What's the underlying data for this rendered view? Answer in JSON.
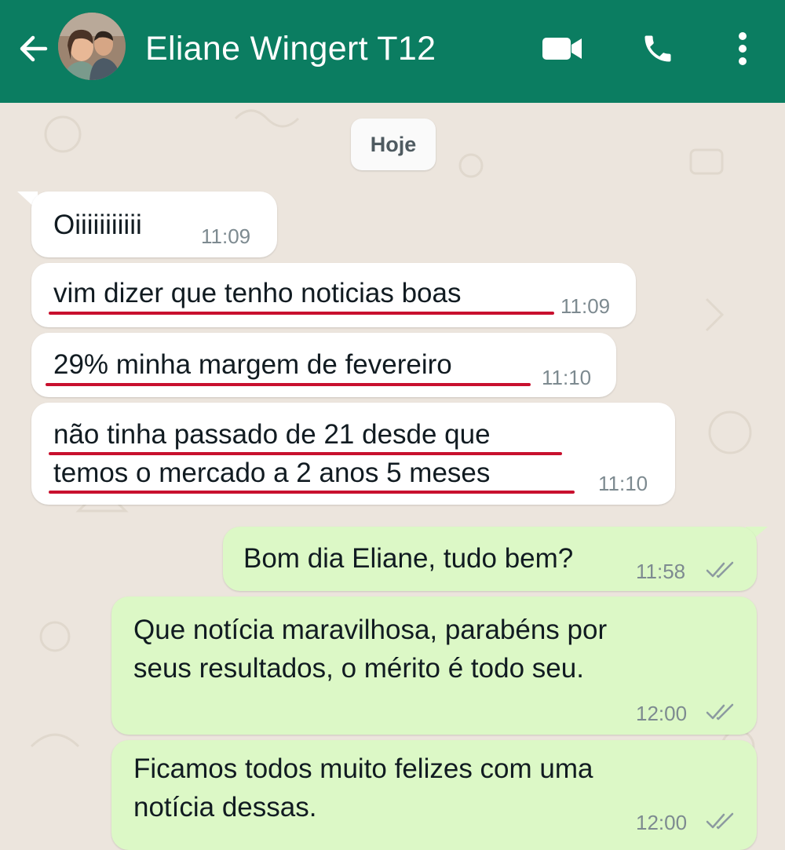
{
  "header": {
    "contact_name": "Eliane Wingert T12",
    "back_icon": "arrow-left-icon",
    "video_icon": "video-camera-icon",
    "call_icon": "phone-icon",
    "menu_icon": "more-vertical-icon",
    "background_color": "#0b7d61"
  },
  "chat": {
    "date_label": "Hoje",
    "messages": [
      {
        "direction": "incoming",
        "text": "Oiiiiiiiiiii",
        "time": "11:09",
        "underlined": false
      },
      {
        "direction": "incoming",
        "text": "vim dizer que tenho noticias boas",
        "time": "11:09",
        "underlined": true
      },
      {
        "direction": "incoming",
        "text": "29% minha margem de fevereiro",
        "time": "11:10",
        "underlined": true
      },
      {
        "direction": "incoming",
        "text": "não tinha passado de 21 desde que\ntemos o mercado a 2 anos 5 meses",
        "time": "11:10",
        "underlined": true
      },
      {
        "direction": "outgoing",
        "text": "Bom dia Eliane, tudo bem?",
        "time": "11:58",
        "status": "read-double-check"
      },
      {
        "direction": "outgoing",
        "text": "Que notícia maravilhosa, parabéns por\nseus resultados, o mérito é todo seu.",
        "time": "12:00",
        "status": "read-double-check"
      },
      {
        "direction": "outgoing",
        "text": "Ficamos todos muito felizes com uma\nnotícia dessas.",
        "time": "12:00",
        "status": "read-double-check"
      }
    ],
    "colors": {
      "incoming_bubble": "#ffffff",
      "outgoing_bubble": "#dcf8c6",
      "underline": "#c8102e",
      "wallpaper": "#ece5dd"
    }
  }
}
